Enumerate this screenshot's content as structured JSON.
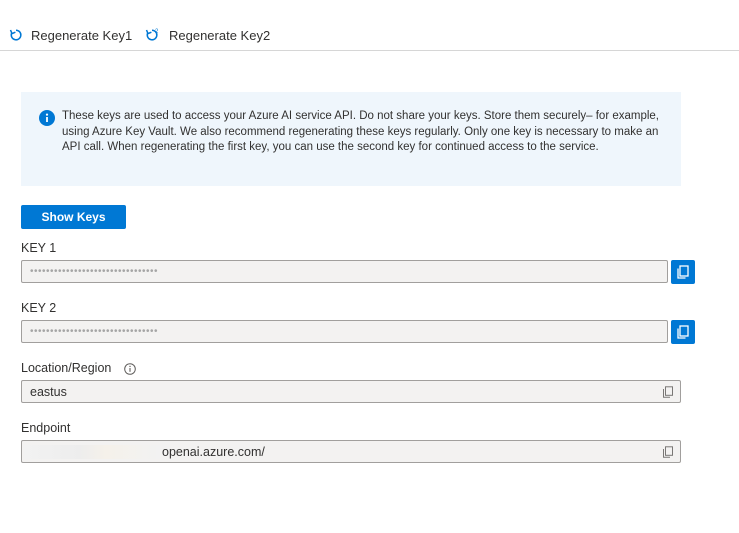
{
  "toolbar": {
    "regenerate_key1": "Regenerate Key1",
    "regenerate_key2": "Regenerate Key2"
  },
  "info": {
    "text": "These keys are used to access your Azure AI service API. Do not share your keys. Store them securely– for example, using Azure Key Vault. We also recommend regenerating these keys regularly. Only one key is necessary to make an API call. When regenerating the first key, you can use the second key for continued access to the service."
  },
  "show_keys_label": "Show Keys",
  "key1": {
    "label": "KEY 1",
    "value": "••••••••••••••••••••••••••••••••"
  },
  "key2": {
    "label": "KEY 2",
    "value": "••••••••••••••••••••••••••••••••"
  },
  "location": {
    "label": "Location/Region",
    "value": "eastus"
  },
  "endpoint": {
    "label": "Endpoint",
    "value_suffix": "openai.azure.com/"
  },
  "colors": {
    "accent": "#0078d4",
    "info_bg": "#eff6fc"
  },
  "icons": {
    "regenerate": "refresh-icon",
    "info": "info-icon",
    "copy": "copy-icon"
  }
}
